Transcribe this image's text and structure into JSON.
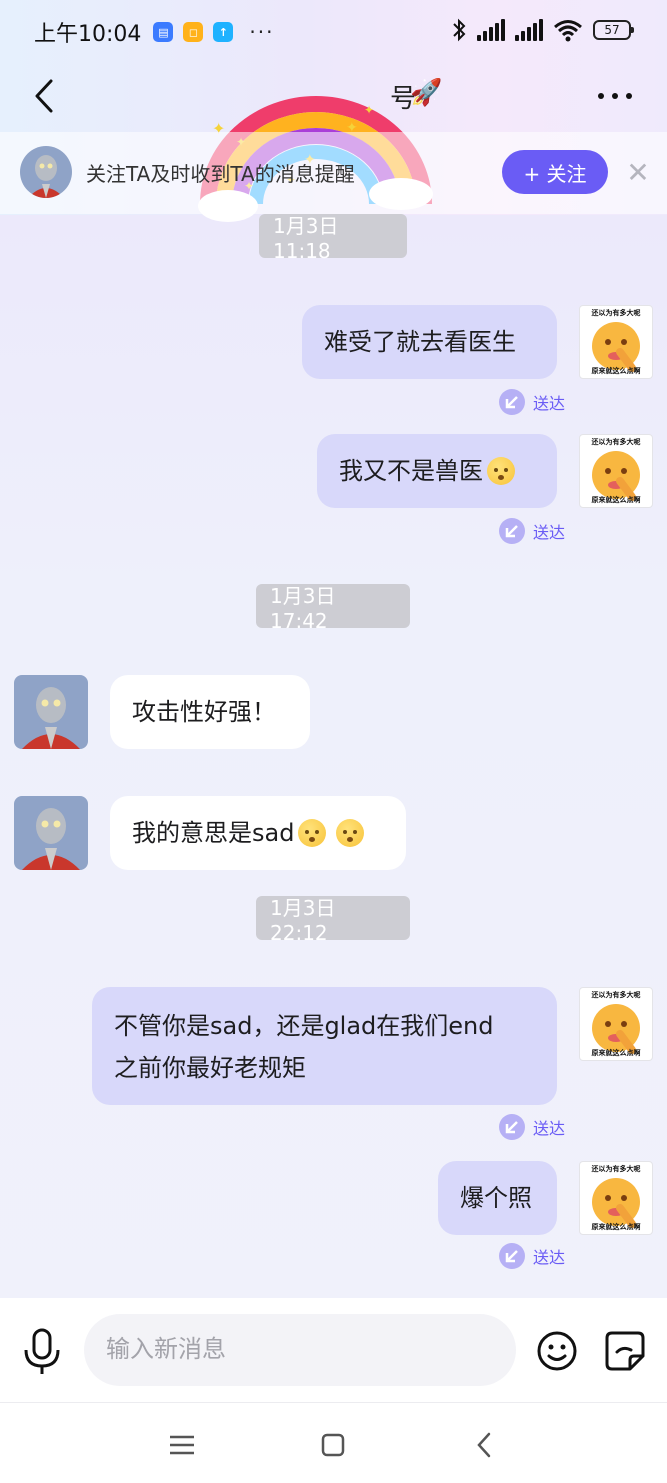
{
  "status_bar": {
    "time": "上午10:04",
    "dots": "···",
    "battery": "57"
  },
  "nav": {
    "title_fragment": "号",
    "rocket": "🚀"
  },
  "follow_bar": {
    "prompt": "关注TA及时收到TA的消息提醒",
    "follow_label": "+ 关注",
    "close_label": "✕"
  },
  "messages": {
    "ts1": "1月3日 11:18",
    "m1": "难受了就去看医生",
    "m2": "我又不是兽医",
    "ts2": "1月3日 17:42",
    "m3": "攻击性好强！",
    "m4": "我的意思是sad",
    "ts3": "1月3日 22:12",
    "m5_line1": "不管你是sad，还是glad在我们end",
    "m5_line2": "之前你最好老规矩",
    "m6": "爆个照",
    "delivered": "送达"
  },
  "sticker": {
    "top_text": "还以为有多大呢",
    "bottom_text": "原来就这么点啊"
  },
  "input": {
    "placeholder": "输入新消息"
  },
  "colors": {
    "accent": "#6a5cf5",
    "outgoing_bubble": "#d8d8fa",
    "incoming_bubble": "#ffffff",
    "timestamp_bg": "#cdcdd3"
  }
}
